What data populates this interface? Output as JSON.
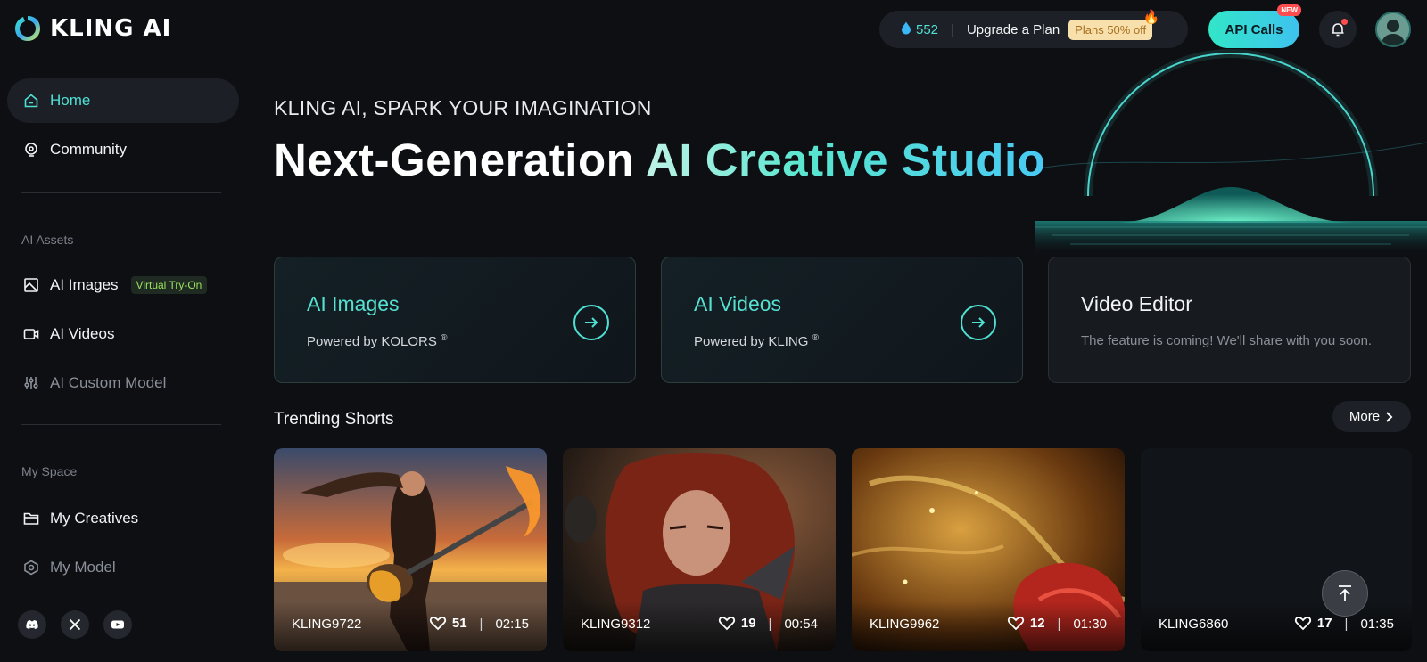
{
  "brand": {
    "name": "KLING AI"
  },
  "sidebar": {
    "items": [
      {
        "label": "Home",
        "icon": "home-icon",
        "active": true
      },
      {
        "label": "Community",
        "icon": "community-icon"
      }
    ],
    "assets_section": "AI Assets",
    "assets": [
      {
        "label": "AI Images",
        "icon": "image-icon",
        "badge": "Virtual Try-On"
      },
      {
        "label": "AI Videos",
        "icon": "video-icon"
      },
      {
        "label": "AI Custom Model",
        "icon": "sliders-icon"
      }
    ],
    "space_section": "My Space",
    "space": [
      {
        "label": "My Creatives",
        "icon": "folder-icon"
      },
      {
        "label": "My Model",
        "icon": "model-icon"
      }
    ],
    "social": [
      "discord-icon",
      "x-icon",
      "youtube-icon"
    ]
  },
  "header": {
    "credits": "552",
    "upgrade_label": "Upgrade a Plan",
    "plans_badge": "Plans 50% off",
    "api_label": "API Calls",
    "api_badge": "NEW"
  },
  "hero": {
    "tagline": "KLING AI, SPARK YOUR IMAGINATION",
    "title_plain": "Next-Generation ",
    "title_gradient": "AI Creative Studio"
  },
  "features": [
    {
      "title": "AI Images",
      "subtitle": "Powered by KOLORS",
      "mark": "®"
    },
    {
      "title": "AI Videos",
      "subtitle": "Powered by KLING",
      "mark": "®"
    },
    {
      "title": "Video Editor",
      "subtitle": "The feature is coming! We'll share with you soon."
    }
  ],
  "trending": {
    "title": "Trending Shorts",
    "more_label": "More",
    "videos": [
      {
        "user": "KLING9722",
        "likes": "51",
        "duration": "02:15"
      },
      {
        "user": "KLING9312",
        "likes": "19",
        "duration": "00:54"
      },
      {
        "user": "KLING9962",
        "likes": "12",
        "duration": "01:30"
      },
      {
        "user": "KLING6860",
        "likes": "17",
        "duration": "01:35"
      }
    ]
  },
  "colors": {
    "accent": "#4fe0d4",
    "background": "#0d0f13",
    "card": "#1d2026"
  }
}
